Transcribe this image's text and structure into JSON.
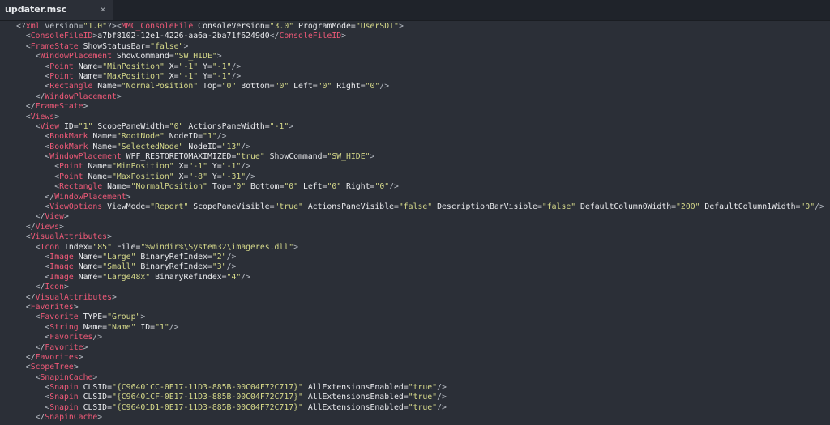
{
  "tab": {
    "title": "updater.msc",
    "close_glyph": "×"
  },
  "editor": {
    "lines": [
      [
        [
          "brk",
          "<?"
        ],
        [
          "pi",
          "xml"
        ],
        [
          "pikw",
          " version="
        ],
        [
          "str",
          "\"1.0\""
        ],
        [
          "brk",
          "?><"
        ],
        [
          "tag",
          "MMC_ConsoleFile"
        ],
        [
          "attr",
          " ConsoleVersion="
        ],
        [
          "str",
          "\"3.0\""
        ],
        [
          "attr",
          " ProgramMode="
        ],
        [
          "str",
          "\"UserSDI\""
        ],
        [
          "brk",
          ">"
        ]
      ],
      [
        [
          "text",
          "  "
        ],
        [
          "brk",
          "<"
        ],
        [
          "tag",
          "ConsoleFileID"
        ],
        [
          "brk",
          ">"
        ],
        [
          "text",
          "a7bf8102-12e1-4226-aa6a-2ba71f6249d0"
        ],
        [
          "brk",
          "</"
        ],
        [
          "tag",
          "ConsoleFileID"
        ],
        [
          "brk",
          ">"
        ]
      ],
      [
        [
          "text",
          "  "
        ],
        [
          "brk",
          "<"
        ],
        [
          "tag",
          "FrameState"
        ],
        [
          "attr",
          " ShowStatusBar="
        ],
        [
          "str",
          "\"false\""
        ],
        [
          "brk",
          ">"
        ]
      ],
      [
        [
          "text",
          "    "
        ],
        [
          "brk",
          "<"
        ],
        [
          "tag",
          "WindowPlacement"
        ],
        [
          "attr",
          " ShowCommand="
        ],
        [
          "str",
          "\"SW_HIDE\""
        ],
        [
          "brk",
          ">"
        ]
      ],
      [
        [
          "text",
          "      "
        ],
        [
          "brk",
          "<"
        ],
        [
          "tag",
          "Point"
        ],
        [
          "attr",
          " Name="
        ],
        [
          "str",
          "\"MinPosition\""
        ],
        [
          "attr",
          " X="
        ],
        [
          "str",
          "\"-1\""
        ],
        [
          "attr",
          " Y="
        ],
        [
          "str",
          "\"-1\""
        ],
        [
          "brk",
          "/>"
        ]
      ],
      [
        [
          "text",
          "      "
        ],
        [
          "brk",
          "<"
        ],
        [
          "tag",
          "Point"
        ],
        [
          "attr",
          " Name="
        ],
        [
          "str",
          "\"MaxPosition\""
        ],
        [
          "attr",
          " X="
        ],
        [
          "str",
          "\"-1\""
        ],
        [
          "attr",
          " Y="
        ],
        [
          "str",
          "\"-1\""
        ],
        [
          "brk",
          "/>"
        ]
      ],
      [
        [
          "text",
          "      "
        ],
        [
          "brk",
          "<"
        ],
        [
          "tag",
          "Rectangle"
        ],
        [
          "attr",
          " Name="
        ],
        [
          "str",
          "\"NormalPosition\""
        ],
        [
          "attr",
          " Top="
        ],
        [
          "str",
          "\"0\""
        ],
        [
          "attr",
          " Bottom="
        ],
        [
          "str",
          "\"0\""
        ],
        [
          "attr",
          " Left="
        ],
        [
          "str",
          "\"0\""
        ],
        [
          "attr",
          " Right="
        ],
        [
          "str",
          "\"0\""
        ],
        [
          "brk",
          "/>"
        ]
      ],
      [
        [
          "text",
          "    "
        ],
        [
          "brk",
          "</"
        ],
        [
          "tag",
          "WindowPlacement"
        ],
        [
          "brk",
          ">"
        ]
      ],
      [
        [
          "text",
          "  "
        ],
        [
          "brk",
          "</"
        ],
        [
          "tag",
          "FrameState"
        ],
        [
          "brk",
          ">"
        ]
      ],
      [
        [
          "text",
          "  "
        ],
        [
          "brk",
          "<"
        ],
        [
          "tag",
          "Views"
        ],
        [
          "brk",
          ">"
        ]
      ],
      [
        [
          "text",
          "    "
        ],
        [
          "brk",
          "<"
        ],
        [
          "tag",
          "View"
        ],
        [
          "attr",
          " ID="
        ],
        [
          "str",
          "\"1\""
        ],
        [
          "attr",
          " ScopePaneWidth="
        ],
        [
          "str",
          "\"0\""
        ],
        [
          "attr",
          " ActionsPaneWidth="
        ],
        [
          "str",
          "\"-1\""
        ],
        [
          "brk",
          ">"
        ]
      ],
      [
        [
          "text",
          "      "
        ],
        [
          "brk",
          "<"
        ],
        [
          "tag",
          "BookMark"
        ],
        [
          "attr",
          " Name="
        ],
        [
          "str",
          "\"RootNode\""
        ],
        [
          "attr",
          " NodeID="
        ],
        [
          "str",
          "\"1\""
        ],
        [
          "brk",
          "/>"
        ]
      ],
      [
        [
          "text",
          "      "
        ],
        [
          "brk",
          "<"
        ],
        [
          "tag",
          "BookMark"
        ],
        [
          "attr",
          " Name="
        ],
        [
          "str",
          "\"SelectedNode\""
        ],
        [
          "attr",
          " NodeID="
        ],
        [
          "str",
          "\"13\""
        ],
        [
          "brk",
          "/>"
        ]
      ],
      [
        [
          "text",
          "      "
        ],
        [
          "brk",
          "<"
        ],
        [
          "tag",
          "WindowPlacement"
        ],
        [
          "attr",
          " WPF_RESTORETOMAXIMIZED="
        ],
        [
          "str",
          "\"true\""
        ],
        [
          "attr",
          " ShowCommand="
        ],
        [
          "str",
          "\"SW_HIDE\""
        ],
        [
          "brk",
          ">"
        ]
      ],
      [
        [
          "text",
          "        "
        ],
        [
          "brk",
          "<"
        ],
        [
          "tag",
          "Point"
        ],
        [
          "attr",
          " Name="
        ],
        [
          "str",
          "\"MinPosition\""
        ],
        [
          "attr",
          " X="
        ],
        [
          "str",
          "\"-1\""
        ],
        [
          "attr",
          " Y="
        ],
        [
          "str",
          "\"-1\""
        ],
        [
          "brk",
          "/>"
        ]
      ],
      [
        [
          "text",
          "        "
        ],
        [
          "brk",
          "<"
        ],
        [
          "tag",
          "Point"
        ],
        [
          "attr",
          " Name="
        ],
        [
          "str",
          "\"MaxPosition\""
        ],
        [
          "attr",
          " X="
        ],
        [
          "str",
          "\"-8\""
        ],
        [
          "attr",
          " Y="
        ],
        [
          "str",
          "\"-31\""
        ],
        [
          "brk",
          "/>"
        ]
      ],
      [
        [
          "text",
          "        "
        ],
        [
          "brk",
          "<"
        ],
        [
          "tag",
          "Rectangle"
        ],
        [
          "attr",
          " Name="
        ],
        [
          "str",
          "\"NormalPosition\""
        ],
        [
          "attr",
          " Top="
        ],
        [
          "str",
          "\"0\""
        ],
        [
          "attr",
          " Bottom="
        ],
        [
          "str",
          "\"0\""
        ],
        [
          "attr",
          " Left="
        ],
        [
          "str",
          "\"0\""
        ],
        [
          "attr",
          " Right="
        ],
        [
          "str",
          "\"0\""
        ],
        [
          "brk",
          "/>"
        ]
      ],
      [
        [
          "text",
          "      "
        ],
        [
          "brk",
          "</"
        ],
        [
          "tag",
          "WindowPlacement"
        ],
        [
          "brk",
          ">"
        ]
      ],
      [
        [
          "text",
          "      "
        ],
        [
          "brk",
          "<"
        ],
        [
          "tag",
          "ViewOptions"
        ],
        [
          "attr",
          " ViewMode="
        ],
        [
          "str",
          "\"Report\""
        ],
        [
          "attr",
          " ScopePaneVisible="
        ],
        [
          "str",
          "\"true\""
        ],
        [
          "attr",
          " ActionsPaneVisible="
        ],
        [
          "str",
          "\"false\""
        ],
        [
          "attr",
          " DescriptionBarVisible="
        ],
        [
          "str",
          "\"false\""
        ],
        [
          "attr",
          " DefaultColumn0Width="
        ],
        [
          "str",
          "\"200\""
        ],
        [
          "attr",
          " DefaultColumn1Width="
        ],
        [
          "str",
          "\"0\""
        ],
        [
          "brk",
          "/>"
        ]
      ],
      [
        [
          "text",
          "    "
        ],
        [
          "brk",
          "</"
        ],
        [
          "tag",
          "View"
        ],
        [
          "brk",
          ">"
        ]
      ],
      [
        [
          "text",
          "  "
        ],
        [
          "brk",
          "</"
        ],
        [
          "tag",
          "Views"
        ],
        [
          "brk",
          ">"
        ]
      ],
      [
        [
          "text",
          "  "
        ],
        [
          "brk",
          "<"
        ],
        [
          "tag",
          "VisualAttributes"
        ],
        [
          "brk",
          ">"
        ]
      ],
      [
        [
          "text",
          "    "
        ],
        [
          "brk",
          "<"
        ],
        [
          "tag",
          "Icon"
        ],
        [
          "attr",
          " Index="
        ],
        [
          "str",
          "\"85\""
        ],
        [
          "attr",
          " File="
        ],
        [
          "str",
          "\"%windir%\\System32\\imageres.dll\""
        ],
        [
          "brk",
          ">"
        ]
      ],
      [
        [
          "text",
          "      "
        ],
        [
          "brk",
          "<"
        ],
        [
          "tag",
          "Image"
        ],
        [
          "attr",
          " Name="
        ],
        [
          "str",
          "\"Large\""
        ],
        [
          "attr",
          " BinaryRefIndex="
        ],
        [
          "str",
          "\"2\""
        ],
        [
          "brk",
          "/>"
        ]
      ],
      [
        [
          "text",
          "      "
        ],
        [
          "brk",
          "<"
        ],
        [
          "tag",
          "Image"
        ],
        [
          "attr",
          " Name="
        ],
        [
          "str",
          "\"Small\""
        ],
        [
          "attr",
          " BinaryRefIndex="
        ],
        [
          "str",
          "\"3\""
        ],
        [
          "brk",
          "/>"
        ]
      ],
      [
        [
          "text",
          "      "
        ],
        [
          "brk",
          "<"
        ],
        [
          "tag",
          "Image"
        ],
        [
          "attr",
          " Name="
        ],
        [
          "str",
          "\"Large48x\""
        ],
        [
          "attr",
          " BinaryRefIndex="
        ],
        [
          "str",
          "\"4\""
        ],
        [
          "brk",
          "/>"
        ]
      ],
      [
        [
          "text",
          "    "
        ],
        [
          "brk",
          "</"
        ],
        [
          "tag",
          "Icon"
        ],
        [
          "brk",
          ">"
        ]
      ],
      [
        [
          "text",
          "  "
        ],
        [
          "brk",
          "</"
        ],
        [
          "tag",
          "VisualAttributes"
        ],
        [
          "brk",
          ">"
        ]
      ],
      [
        [
          "text",
          "  "
        ],
        [
          "brk",
          "<"
        ],
        [
          "tag",
          "Favorites"
        ],
        [
          "brk",
          ">"
        ]
      ],
      [
        [
          "text",
          "    "
        ],
        [
          "brk",
          "<"
        ],
        [
          "tag",
          "Favorite"
        ],
        [
          "attr",
          " TYPE="
        ],
        [
          "str",
          "\"Group\""
        ],
        [
          "brk",
          ">"
        ]
      ],
      [
        [
          "text",
          "      "
        ],
        [
          "brk",
          "<"
        ],
        [
          "tag",
          "String"
        ],
        [
          "attr",
          " Name="
        ],
        [
          "str",
          "\"Name\""
        ],
        [
          "attr",
          " ID="
        ],
        [
          "str",
          "\"1\""
        ],
        [
          "brk",
          "/>"
        ]
      ],
      [
        [
          "text",
          "      "
        ],
        [
          "brk",
          "<"
        ],
        [
          "tag",
          "Favorites"
        ],
        [
          "brk",
          "/>"
        ]
      ],
      [
        [
          "text",
          "    "
        ],
        [
          "brk",
          "</"
        ],
        [
          "tag",
          "Favorite"
        ],
        [
          "brk",
          ">"
        ]
      ],
      [
        [
          "text",
          "  "
        ],
        [
          "brk",
          "</"
        ],
        [
          "tag",
          "Favorites"
        ],
        [
          "brk",
          ">"
        ]
      ],
      [
        [
          "text",
          "  "
        ],
        [
          "brk",
          "<"
        ],
        [
          "tag",
          "ScopeTree"
        ],
        [
          "brk",
          ">"
        ]
      ],
      [
        [
          "text",
          "    "
        ],
        [
          "brk",
          "<"
        ],
        [
          "tag",
          "SnapinCache"
        ],
        [
          "brk",
          ">"
        ]
      ],
      [
        [
          "text",
          "      "
        ],
        [
          "brk",
          "<"
        ],
        [
          "tag",
          "Snapin"
        ],
        [
          "attr",
          " CLSID="
        ],
        [
          "str",
          "\"{C96401CC-0E17-11D3-885B-00C04F72C717}\""
        ],
        [
          "attr",
          " AllExtensionsEnabled="
        ],
        [
          "str",
          "\"true\""
        ],
        [
          "brk",
          "/>"
        ]
      ],
      [
        [
          "text",
          "      "
        ],
        [
          "brk",
          "<"
        ],
        [
          "tag",
          "Snapin"
        ],
        [
          "attr",
          " CLSID="
        ],
        [
          "str",
          "\"{C96401CF-0E17-11D3-885B-00C04F72C717}\""
        ],
        [
          "attr",
          " AllExtensionsEnabled="
        ],
        [
          "str",
          "\"true\""
        ],
        [
          "brk",
          "/>"
        ]
      ],
      [
        [
          "text",
          "      "
        ],
        [
          "brk",
          "<"
        ],
        [
          "tag",
          "Snapin"
        ],
        [
          "attr",
          " CLSID="
        ],
        [
          "str",
          "\"{C96401D1-0E17-11D3-885B-00C04F72C717}\""
        ],
        [
          "attr",
          " AllExtensionsEnabled="
        ],
        [
          "str",
          "\"true\""
        ],
        [
          "brk",
          "/>"
        ]
      ],
      [
        [
          "text",
          "    "
        ],
        [
          "brk",
          "</"
        ],
        [
          "tag",
          "SnapinCache"
        ],
        [
          "brk",
          ">"
        ]
      ]
    ]
  }
}
